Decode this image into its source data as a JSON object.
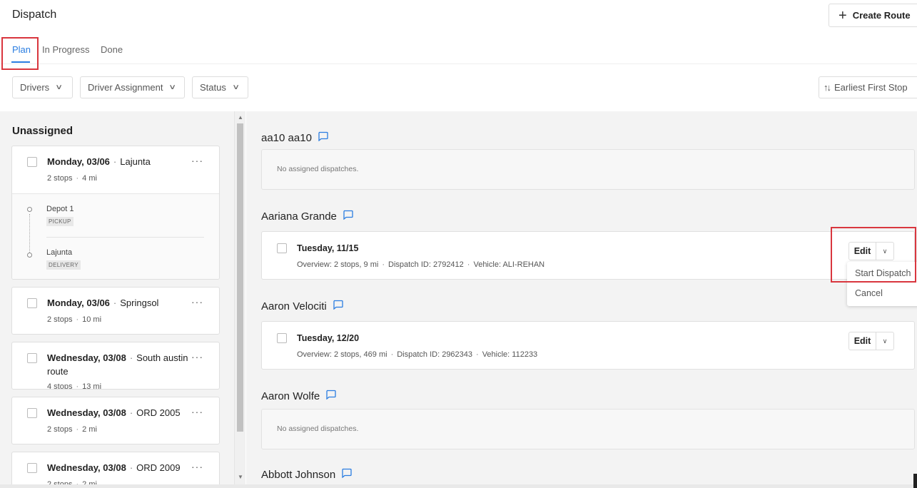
{
  "header": {
    "title": "Dispatch",
    "create_route_label": "Create Route"
  },
  "tabs": [
    {
      "label": "Plan",
      "active": true
    },
    {
      "label": "In Progress",
      "active": false
    },
    {
      "label": "Done",
      "active": false
    }
  ],
  "filters": [
    {
      "label": "Drivers"
    },
    {
      "label": "Driver Assignment"
    },
    {
      "label": "Status"
    }
  ],
  "sort": {
    "label": "Earliest First Stop"
  },
  "unassigned": {
    "title": "Unassigned",
    "cards": [
      {
        "date": "Monday, 03/06",
        "place": "Lajunta",
        "stops": "2 stops",
        "distance": "4 mi",
        "stop_list": [
          {
            "name": "Depot 1",
            "tag": "PICKUP"
          },
          {
            "name": "Lajunta",
            "tag": "DELIVERY"
          }
        ]
      },
      {
        "date": "Monday, 03/06",
        "place": "Springsol",
        "stops": "2 stops",
        "distance": "10 mi"
      },
      {
        "date": "Wednesday, 03/08",
        "place": "South austin",
        "place_line2": "route",
        "stops": "4 stops",
        "distance": "13 mi"
      },
      {
        "date": "Wednesday, 03/08",
        "place": "ORD 2005",
        "stops": "2 stops",
        "distance": "2 mi"
      },
      {
        "date": "Wednesday, 03/08",
        "place": "ORD 2009",
        "stops": "2 stops",
        "distance": "2 mi"
      }
    ]
  },
  "drivers": [
    {
      "name": "aa10 aa10",
      "empty_text": "No assigned dispatches."
    },
    {
      "name": "Aariana Grande",
      "dispatch": {
        "date": "Tuesday, 11/15",
        "overview": "Overview: 2 stops, 9 mi",
        "dispatch_id": "Dispatch ID: 2792412",
        "vehicle": "Vehicle: ALI-REHAN",
        "edit_label": "Edit"
      }
    },
    {
      "name": "Aaron Velociti",
      "dispatch": {
        "date": "Tuesday, 12/20",
        "overview": "Overview: 2 stops, 469 mi",
        "dispatch_id": "Dispatch ID: 2962343",
        "vehicle": "Vehicle: 112233",
        "edit_label": "Edit"
      }
    },
    {
      "name": "Aaron Wolfe",
      "empty_text": "No assigned dispatches."
    },
    {
      "name": "Abbott Johnson"
    }
  ],
  "dropdown_menu": {
    "items": [
      "Start Dispatch",
      "Cancel"
    ]
  },
  "colors": {
    "accent": "#2a7de1",
    "highlight": "#d9363e",
    "panel_bg": "#f3f3f3"
  },
  "icons": {
    "create": "plus-icon",
    "chevron": "chevron-down-icon",
    "sort": "sort-arrows-icon",
    "chat": "chat-bubble-icon",
    "more": "ellipsis-icon"
  }
}
